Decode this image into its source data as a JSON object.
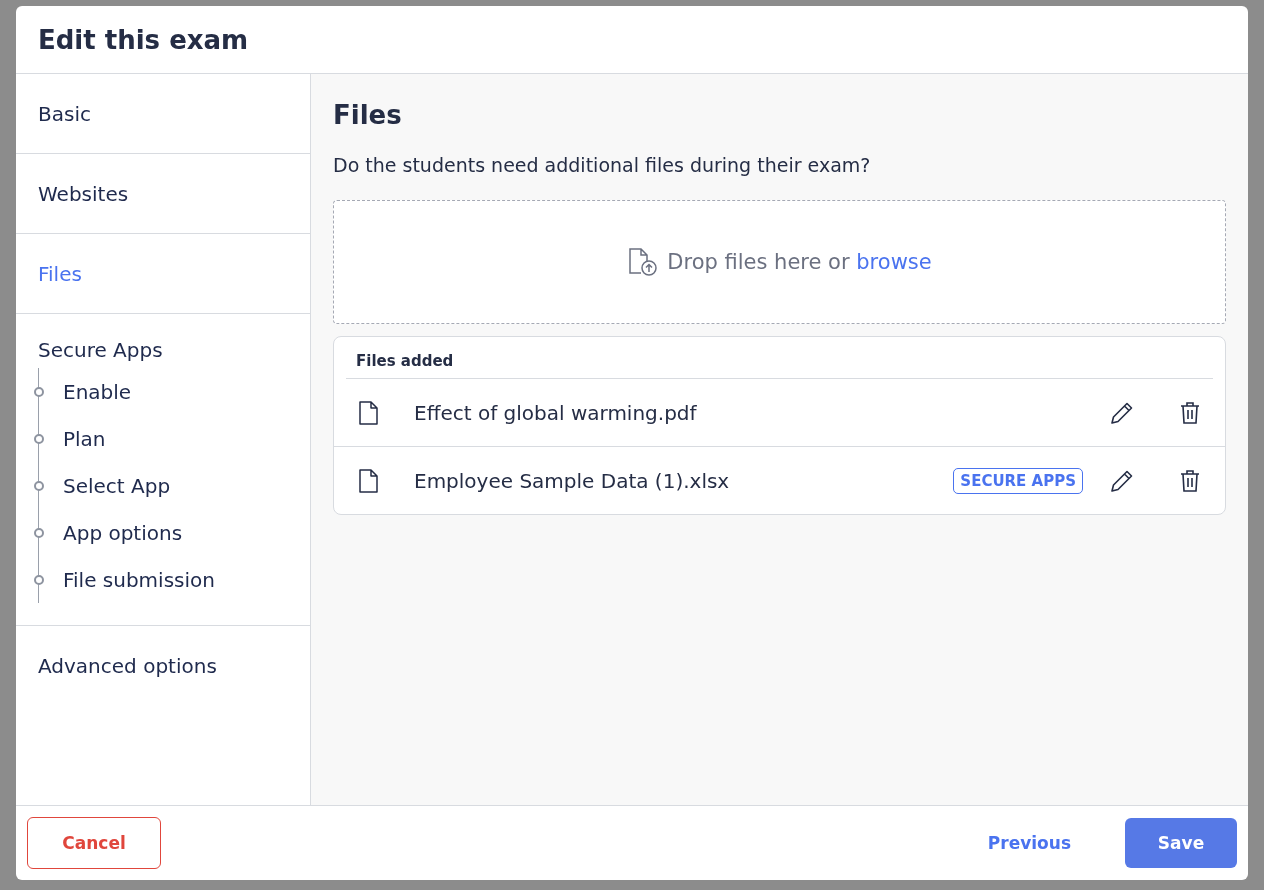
{
  "window": {
    "title": "Edit this exam"
  },
  "sidebar": {
    "items": [
      {
        "label": "Basic",
        "selected": false
      },
      {
        "label": "Websites",
        "selected": false
      },
      {
        "label": "Files",
        "selected": true
      },
      {
        "label": "Secure Apps",
        "selected": false,
        "children": [
          {
            "label": "Enable"
          },
          {
            "label": "Plan"
          },
          {
            "label": "Select App"
          },
          {
            "label": "App options"
          },
          {
            "label": "File submission"
          }
        ]
      },
      {
        "label": "Advanced options",
        "selected": false
      }
    ]
  },
  "content": {
    "title": "Files",
    "question": "Do the students need additional files during their exam?",
    "dropzone": {
      "text": "Drop files here or",
      "link": "browse"
    },
    "files": {
      "heading": "Files added",
      "rows": [
        {
          "name": "Effect of global warming.pdf"
        },
        {
          "name": "Employee Sample Data (1).xlsx",
          "badge": "SECURE APPS"
        }
      ]
    }
  },
  "footer": {
    "cancel": "Cancel",
    "previous": "Previous",
    "save": "Save"
  }
}
